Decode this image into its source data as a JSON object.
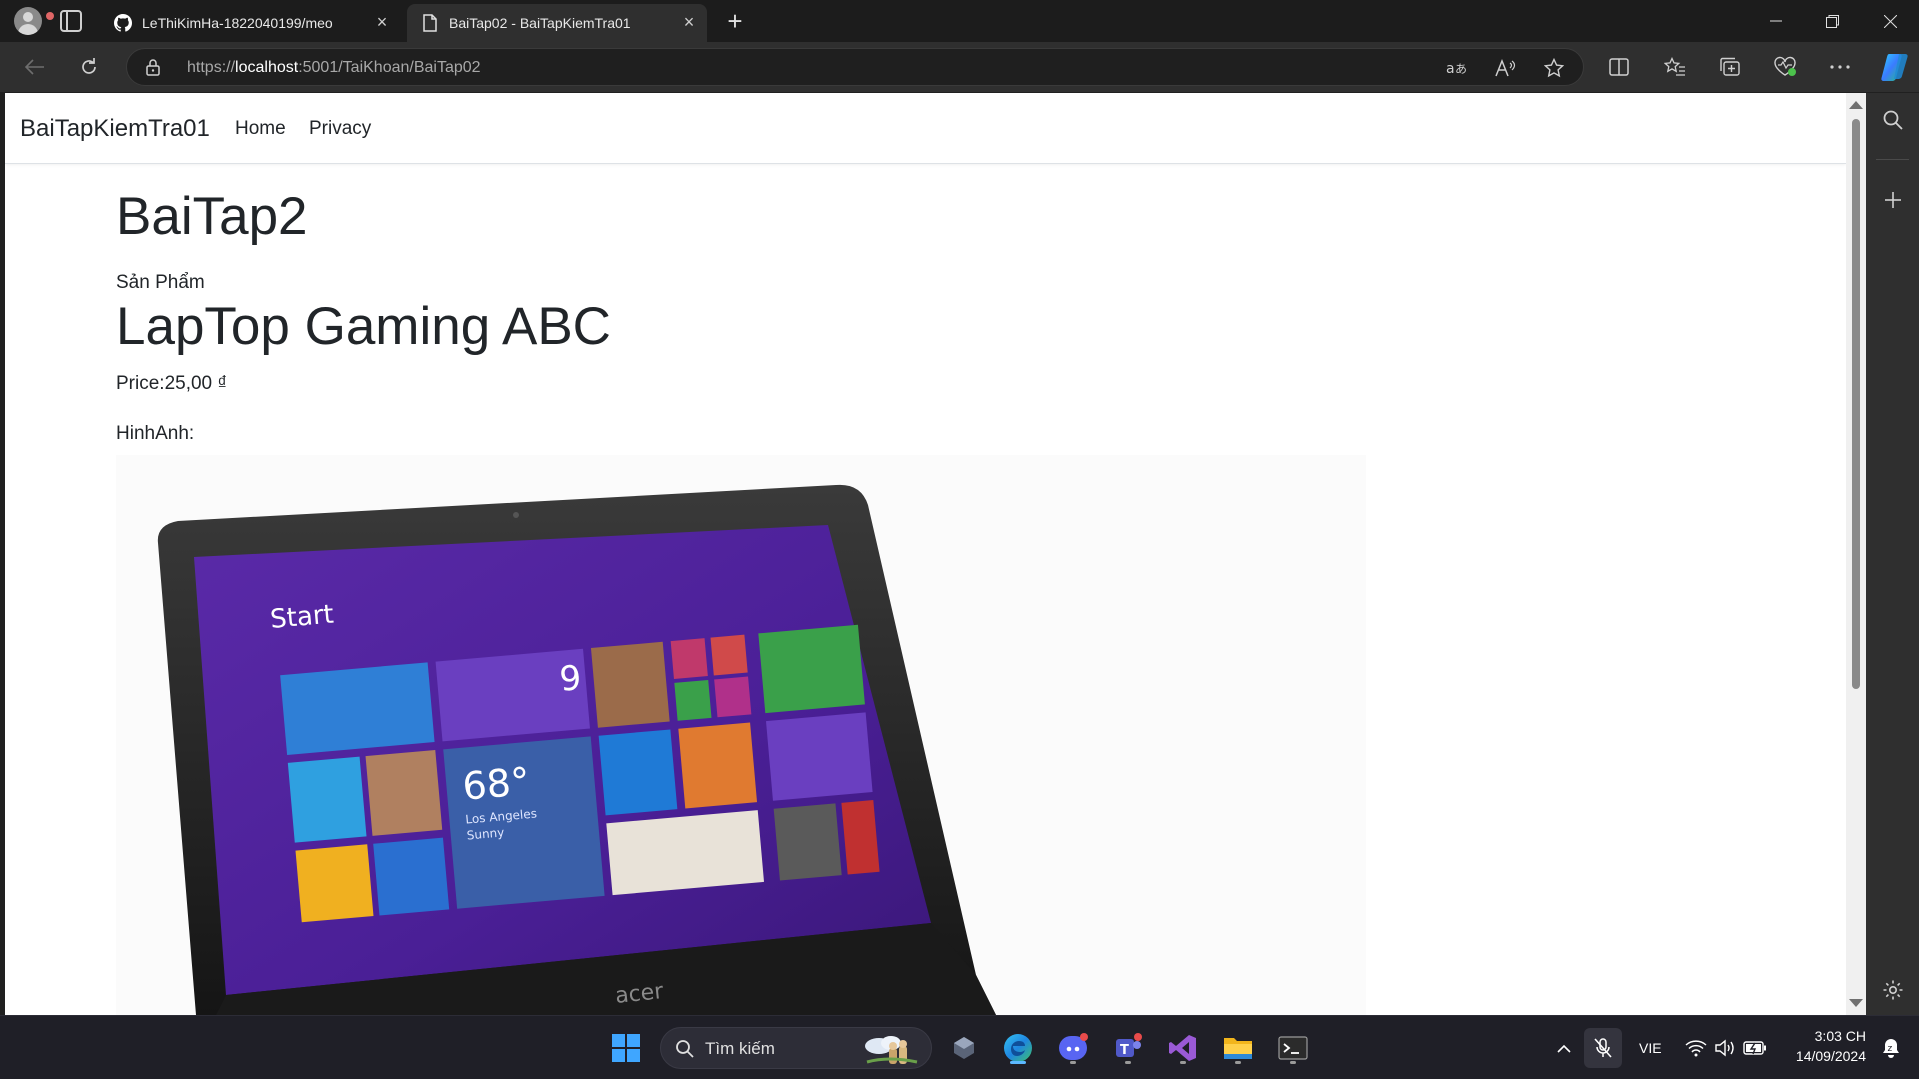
{
  "browser": {
    "tabs": [
      {
        "title": "LeThiKimHa-1822040199/meo",
        "icon": "github-icon"
      },
      {
        "title": "BaiTap02 - BaiTapKiemTra01",
        "icon": "page-icon"
      }
    ],
    "url_prefix": "https://",
    "url_host": "localhost",
    "url_rest": ":5001/TaiKhoan/BaiTap02"
  },
  "site": {
    "brand": "BaiTapKiemTra01",
    "nav": [
      "Home",
      "Privacy"
    ]
  },
  "page": {
    "heading": "BaiTap2",
    "section_label": "Sản Phẩm",
    "product_name": "LapTop Gaming ABC",
    "price_label": "Price:",
    "price_value": "25,00 ₫",
    "image_label": "HinhAnh:"
  },
  "laptop_screen": {
    "start_label": "Start",
    "weather_temp": "68°",
    "weather_city": "Los Angeles",
    "weather_cond": "Sunny",
    "calendar_day": "9",
    "brand_mark": "acer"
  },
  "taskbar": {
    "search_placeholder": "Tìm kiếm",
    "language": "VIE",
    "time": "3:03 CH",
    "date": "14/09/2024"
  }
}
